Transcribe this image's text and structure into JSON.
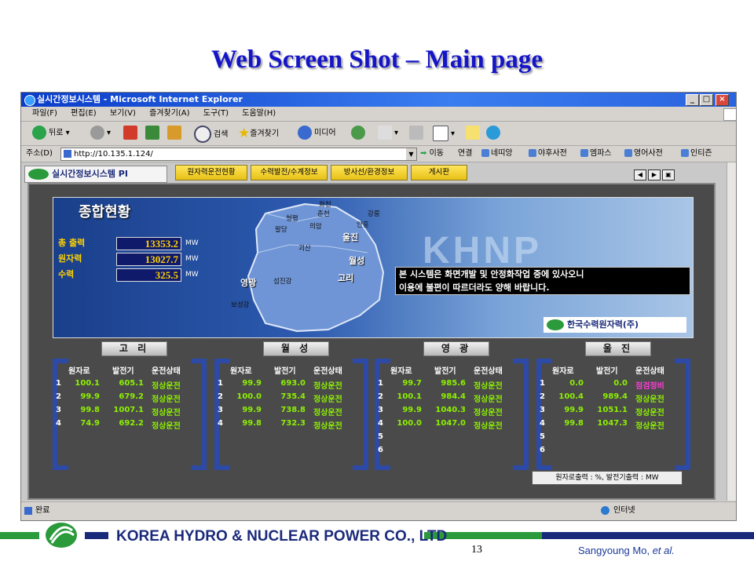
{
  "slide": {
    "title": "Web Screen Shot – Main page",
    "page_number": "13",
    "author_name": "Sangyoung Mo, ",
    "author_etal": "et al.",
    "company": "KOREA HYDRO & NUCLEAR POWER CO., LTD"
  },
  "browser": {
    "title": "실시간정보시스템 - Microsoft Internet Explorer",
    "menu": [
      "파일(F)",
      "편집(E)",
      "보기(V)",
      "즐겨찾기(A)",
      "도구(T)",
      "도움말(H)"
    ],
    "toolbar": {
      "back": "뒤로",
      "search": "검색",
      "favorites": "즐겨찾기",
      "media": "미디어"
    },
    "address_label": "주소(D)",
    "address_url": "http://10.135.1.124/",
    "go_label": "이동",
    "links_label": "연결",
    "links": [
      "네띠앙",
      "야후사전",
      "엠파스",
      "영어사전",
      "인티즌"
    ],
    "status_text": "완료",
    "zone_text": "인터넷"
  },
  "site": {
    "logo": "실시간정보시스템 PI",
    "tabs": [
      "원자력운전현황",
      "수력발전/수계정보",
      "방사선/환경정보",
      "게시판"
    ],
    "overview_title": "종합현황",
    "outputs": [
      {
        "label": "총 출력",
        "value": "13353.2",
        "unit": "MW"
      },
      {
        "label": "원자력",
        "value": "13027.7",
        "unit": "MW"
      },
      {
        "label": "수력",
        "value": "325.5",
        "unit": "MW"
      }
    ],
    "map_plants": [
      "울진",
      "월성",
      "고리",
      "영광"
    ],
    "map_cities": [
      "화천",
      "춘천",
      "청평",
      "팔당",
      "의암",
      "강릉",
      "안흥",
      "괴산",
      "섬진강",
      "보성강"
    ],
    "watermark": "KHNP",
    "notice": [
      "본 시스템은 화면개발 및 안정화작업 중에 있사오니",
      "이용에 불편이 따르더라도 양해 바랍니다."
    ],
    "corp_logo": "한국수력원자력(주)",
    "unit_note": "원자로출력 : %, 발전기출력 : MW",
    "col_headers": [
      "원자로",
      "발전기",
      "운전상태"
    ],
    "plants": [
      {
        "name": "고 리",
        "rows": [
          {
            "no": "1",
            "reactor": "100.1",
            "gen": "605.1",
            "status": "정상운전"
          },
          {
            "no": "2",
            "reactor": "99.9",
            "gen": "679.2",
            "status": "정상운전"
          },
          {
            "no": "3",
            "reactor": "99.8",
            "gen": "1007.1",
            "status": "정상운전"
          },
          {
            "no": "4",
            "reactor": "74.9",
            "gen": "692.2",
            "status": "정상운전"
          }
        ]
      },
      {
        "name": "월 성",
        "rows": [
          {
            "no": "1",
            "reactor": "99.9",
            "gen": "693.0",
            "status": "정상운전"
          },
          {
            "no": "2",
            "reactor": "100.0",
            "gen": "735.4",
            "status": "정상운전"
          },
          {
            "no": "3",
            "reactor": "99.9",
            "gen": "738.8",
            "status": "정상운전"
          },
          {
            "no": "4",
            "reactor": "99.8",
            "gen": "732.3",
            "status": "정상운전"
          }
        ]
      },
      {
        "name": "영 광",
        "rows": [
          {
            "no": "1",
            "reactor": "99.7",
            "gen": "985.6",
            "status": "정상운전"
          },
          {
            "no": "2",
            "reactor": "100.1",
            "gen": "984.4",
            "status": "정상운전"
          },
          {
            "no": "3",
            "reactor": "99.9",
            "gen": "1040.3",
            "status": "정상운전"
          },
          {
            "no": "4",
            "reactor": "100.0",
            "gen": "1047.0",
            "status": "정상운전"
          },
          {
            "no": "5",
            "reactor": "",
            "gen": "",
            "status": ""
          },
          {
            "no": "6",
            "reactor": "",
            "gen": "",
            "status": ""
          }
        ]
      },
      {
        "name": "울 진",
        "rows": [
          {
            "no": "1",
            "reactor": "0.0",
            "gen": "0.0",
            "status": "점검정비"
          },
          {
            "no": "2",
            "reactor": "100.4",
            "gen": "989.4",
            "status": "정상운전"
          },
          {
            "no": "3",
            "reactor": "99.9",
            "gen": "1051.1",
            "status": "정상운전"
          },
          {
            "no": "4",
            "reactor": "99.8",
            "gen": "1047.3",
            "status": "정상운전"
          },
          {
            "no": "5",
            "reactor": "",
            "gen": "",
            "status": ""
          },
          {
            "no": "6",
            "reactor": "",
            "gen": "",
            "status": ""
          }
        ]
      }
    ]
  },
  "colors": {
    "normal_status": "#8cf000",
    "maintenance_status": "#ff3ad8",
    "title_blue": "#1515c8"
  }
}
